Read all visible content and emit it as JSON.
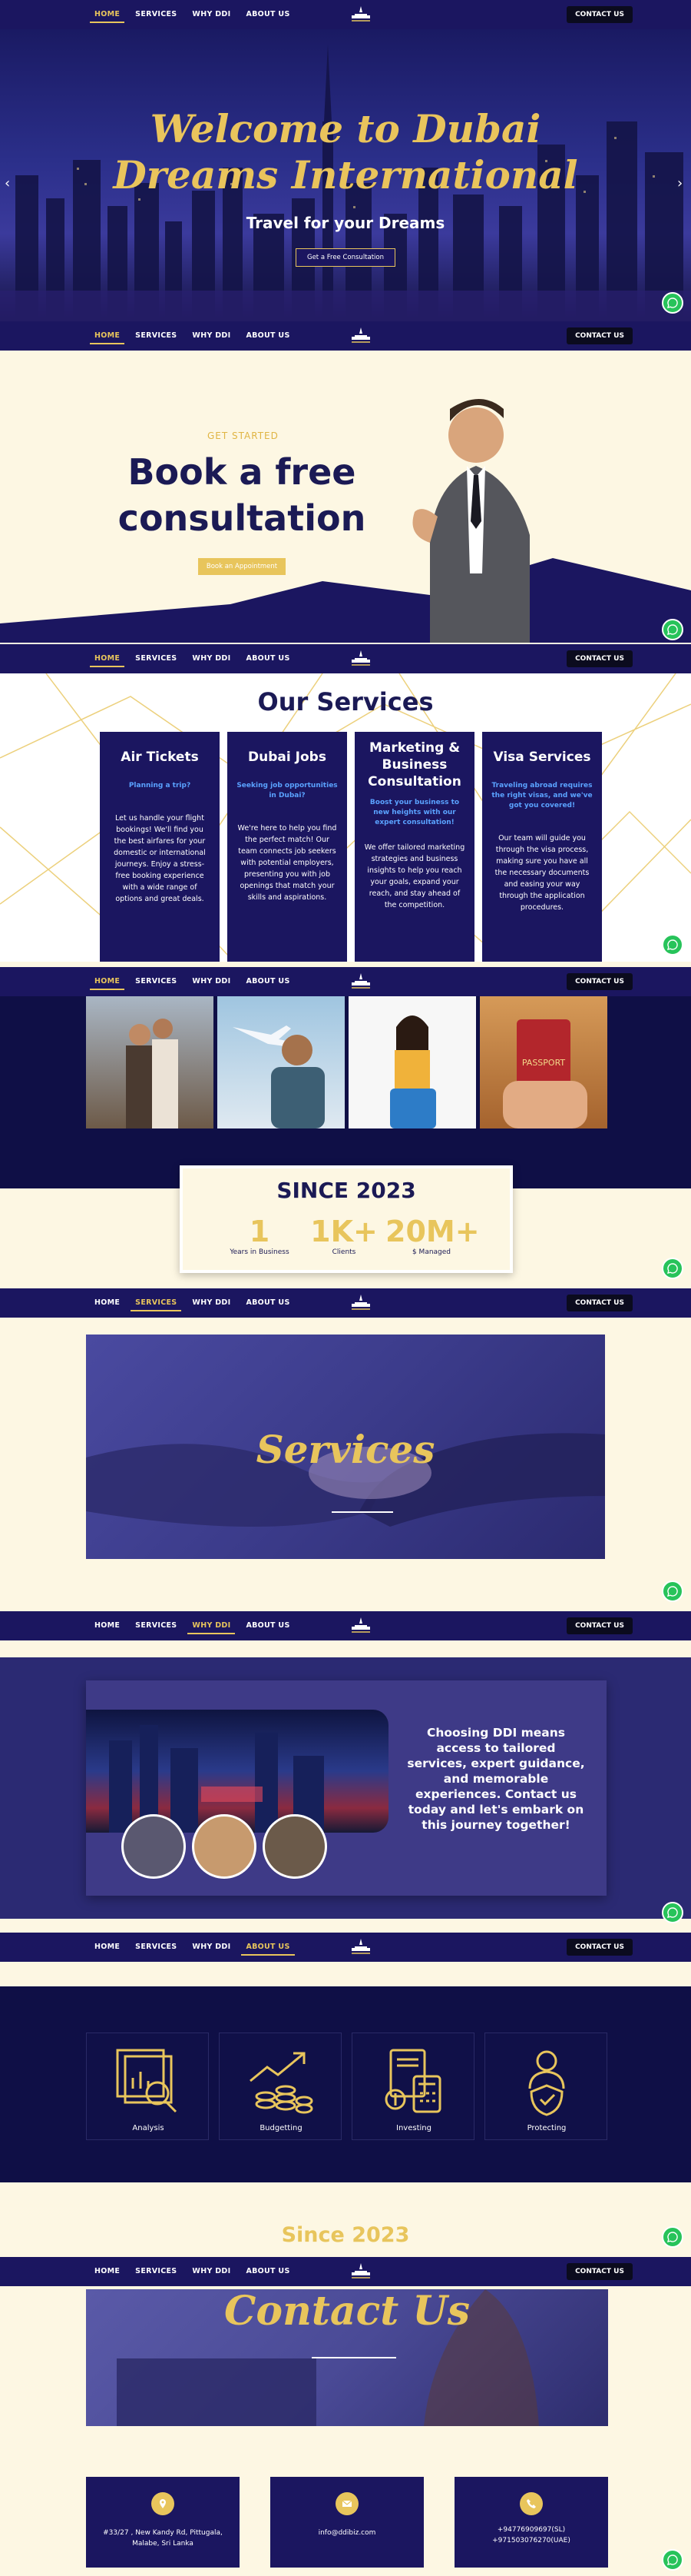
{
  "nav": {
    "items": [
      "HOME",
      "SERVICES",
      "WHY DDI",
      "ABOUT US"
    ],
    "contact": "CONTACT US",
    "logo_text": "Dubai Dreams"
  },
  "hero": {
    "title_line1": "Welcome to Dubai",
    "title_line2": "Dreams International",
    "subtitle": "Travel for your Dreams",
    "button": "Get a Free Consultation"
  },
  "consult": {
    "eyebrow": "GET STARTED",
    "heading": "Book a free consultation",
    "button": "Book an Appointment"
  },
  "services": {
    "title": "Our Services",
    "cards": [
      {
        "title": "Air Tickets",
        "lead": "Planning a trip?",
        "body": "Let us handle your flight bookings! We'll find you the best airfares for your domestic or international journeys. Enjoy a stress-free booking experience with a wide range of options and great deals."
      },
      {
        "title": "Dubai Jobs",
        "lead": "Seeking job opportunities in Dubai?",
        "body": "We're here to help you find the perfect match! Our team connects job seekers with potential employers, presenting you with job openings that match your skills and aspirations."
      },
      {
        "title": "Marketing & Business Consultation",
        "lead": "Boost your business to new heights with our expert consultation!",
        "body": "We offer tailored marketing strategies and business insights to help you reach your goals, expand your reach, and stay ahead of the competition."
      },
      {
        "title": "Visa Services",
        "lead": "Traveling abroad requires the right visas, and we've got you covered!",
        "body": "Our team will guide you through the visa process, making sure you have all the necessary documents and easing your way through the application procedures."
      }
    ]
  },
  "stats": {
    "heading": "SINCE 2023",
    "items": [
      {
        "value": "1",
        "label": "Years in Business"
      },
      {
        "value": "1K+",
        "label": "Clients"
      },
      {
        "value": "20M+",
        "label": "$ Managed"
      }
    ]
  },
  "services_banner": {
    "word": "Services"
  },
  "why": {
    "text": "Choosing DDI means access to tailored services, expert guidance, and memorable experiences. Contact us today and let's embark on this journey together!"
  },
  "about": {
    "features": [
      "Analysis",
      "Budgetting",
      "Investing",
      "Protecting"
    ],
    "since": "Since 2023"
  },
  "contact": {
    "word": "Contact Us",
    "address": "#33/27 , New Kandy Rd, Pittugala, Malabe, Sri Lanka",
    "email": "info@ddibiz.com",
    "phone1": "+94776909697(SL)",
    "phone2": "+971503076270(UAE)"
  },
  "colors": {
    "navy": "#1b1660",
    "gold": "#e8c55c",
    "cream": "#fdf7e3",
    "whatsapp": "#27c35a"
  }
}
